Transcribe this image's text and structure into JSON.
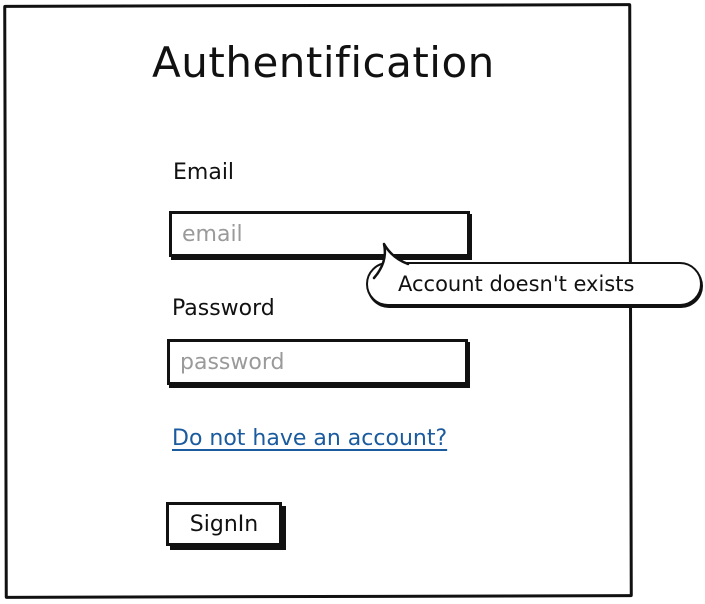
{
  "page": {
    "title": "Authentification"
  },
  "form": {
    "email_label": "Email",
    "email_placeholder": "email",
    "email_value": "",
    "password_label": "Password",
    "password_placeholder": "password",
    "password_value": "",
    "signup_link": "Do not have an account?",
    "signin_label": "SignIn"
  },
  "tooltip": {
    "message": "Account doesn't exists"
  },
  "colors": {
    "link": "#1a5a9e",
    "border": "#111111",
    "placeholder": "#9a9a9a"
  }
}
